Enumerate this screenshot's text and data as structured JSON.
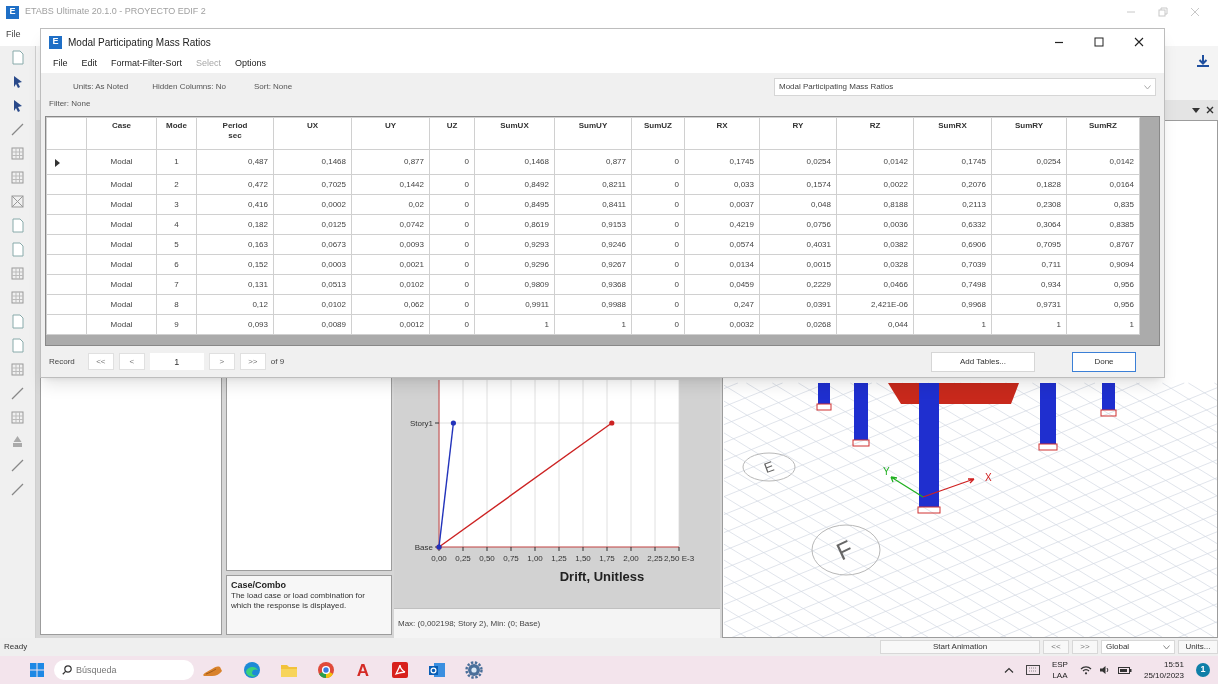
{
  "main_window": {
    "logo": "E",
    "title": "ETABS Ultimate 20.1.0 - PROYECTO EDIF 2",
    "menu": [
      "File"
    ]
  },
  "dialog": {
    "logo": "E",
    "title": "Modal Participating Mass Ratios",
    "menu": [
      {
        "label": "File",
        "disabled": false
      },
      {
        "label": "Edit",
        "disabled": false
      },
      {
        "label": "Format-Filter-Sort",
        "disabled": false
      },
      {
        "label": "Select",
        "disabled": true
      },
      {
        "label": "Options",
        "disabled": false
      }
    ],
    "info": [
      "Units: As Noted",
      "Hidden Columns: No",
      "Sort: None"
    ],
    "filter": "Filter: None",
    "table_select": "Modal Participating Mass Ratios",
    "table": {
      "columns": [
        {
          "label": "Case"
        },
        {
          "label": "Mode"
        },
        {
          "label": "Period",
          "unit": "sec"
        },
        {
          "label": "UX"
        },
        {
          "label": "UY"
        },
        {
          "label": "UZ"
        },
        {
          "label": "SumUX"
        },
        {
          "label": "SumUY"
        },
        {
          "label": "SumUZ"
        },
        {
          "label": "RX"
        },
        {
          "label": "RY"
        },
        {
          "label": "RZ"
        },
        {
          "label": "SumRX"
        },
        {
          "label": "SumRY"
        },
        {
          "label": "SumRZ"
        }
      ],
      "rows": [
        {
          "selected": true,
          "cells": [
            "Modal",
            "1",
            "0,487",
            "0,1468",
            "0,877",
            "0",
            "0,1468",
            "0,877",
            "0",
            "0,1745",
            "0,0254",
            "0,0142",
            "0,1745",
            "0,0254",
            "0,0142"
          ]
        },
        {
          "selected": false,
          "cells": [
            "Modal",
            "2",
            "0,472",
            "0,7025",
            "0,1442",
            "0",
            "0,8492",
            "0,8211",
            "0",
            "0,033",
            "0,1574",
            "0,0022",
            "0,2076",
            "0,1828",
            "0,0164"
          ]
        },
        {
          "selected": false,
          "cells": [
            "Modal",
            "3",
            "0,416",
            "0,0002",
            "0,02",
            "0",
            "0,8495",
            "0,8411",
            "0",
            "0,0037",
            "0,048",
            "0,8188",
            "0,2113",
            "0,2308",
            "0,835"
          ]
        },
        {
          "selected": false,
          "cells": [
            "Modal",
            "4",
            "0,182",
            "0,0125",
            "0,0742",
            "0",
            "0,8619",
            "0,9153",
            "0",
            "0,4219",
            "0,0756",
            "0,0036",
            "0,6332",
            "0,3064",
            "0,8385"
          ]
        },
        {
          "selected": false,
          "cells": [
            "Modal",
            "5",
            "0,163",
            "0,0673",
            "0,0093",
            "0",
            "0,9293",
            "0,9246",
            "0",
            "0,0574",
            "0,4031",
            "0,0382",
            "0,6906",
            "0,7095",
            "0,8767"
          ]
        },
        {
          "selected": false,
          "cells": [
            "Modal",
            "6",
            "0,152",
            "0,0003",
            "0,0021",
            "0",
            "0,9296",
            "0,9267",
            "0",
            "0,0134",
            "0,0015",
            "0,0328",
            "0,7039",
            "0,711",
            "0,9094"
          ]
        },
        {
          "selected": false,
          "cells": [
            "Modal",
            "7",
            "0,131",
            "0,0513",
            "0,0102",
            "0",
            "0,9809",
            "0,9368",
            "0",
            "0,0459",
            "0,2229",
            "0,0466",
            "0,7498",
            "0,934",
            "0,956"
          ]
        },
        {
          "selected": false,
          "cells": [
            "Modal",
            "8",
            "0,12",
            "0,0102",
            "0,062",
            "0",
            "0,9911",
            "0,9988",
            "0",
            "0,247",
            "0,0391",
            "2,421E-06",
            "0,9968",
            "0,9731",
            "0,956"
          ]
        },
        {
          "selected": false,
          "cells": [
            "Modal",
            "9",
            "0,093",
            "0,0089",
            "0,0012",
            "0",
            "1",
            "1",
            "0",
            "0,0032",
            "0,0268",
            "0,044",
            "1",
            "1",
            "1"
          ]
        }
      ]
    },
    "record_nav": {
      "label": "Record",
      "first": "<<",
      "prev": "<",
      "value": "1",
      "next": ">",
      "last": ">>",
      "count": "of 9"
    },
    "buttons": [
      {
        "label": "Add Tables...",
        "default": false
      },
      {
        "label": "Done",
        "default": true
      }
    ]
  },
  "help_box": {
    "title": "Case/Combo",
    "text": "The load case or load combination for which the response is displayed."
  },
  "drift_plot": {
    "chart_data": {
      "type": "line",
      "orientation": "horizontal",
      "grid": true,
      "xlabel": "Drift, Unitless",
      "categories": [
        "Story1",
        "Base"
      ],
      "xlim": [
        0,
        2.5
      ],
      "xticks": [
        {
          "value": 0,
          "label": "0,00"
        },
        {
          "value": 0.25,
          "label": "0,25"
        },
        {
          "value": 0.5,
          "label": "0,50"
        },
        {
          "value": 0.75,
          "label": "0,75"
        },
        {
          "value": 1,
          "label": "1,00"
        },
        {
          "value": 1.25,
          "label": "1,25"
        },
        {
          "value": 1.5,
          "label": "1,50"
        },
        {
          "value": 1.75,
          "label": "1,75"
        },
        {
          "value": 2,
          "label": "2,00"
        },
        {
          "value": 2.25,
          "label": "2,25"
        },
        {
          "value": 2.5,
          "label": "2,50 E-3"
        }
      ],
      "series": [
        {
          "color": "#cc2222",
          "values": [
            1.8,
            0
          ]
        },
        {
          "color": "#2233bb",
          "values": [
            0.15,
            0
          ]
        }
      ]
    },
    "footer": "Max: (0,002198; Story 2),  Min: (0; Base)"
  },
  "model_view": {
    "grid_labels": [
      "E",
      "F"
    ],
    "axes": [
      "X",
      "Y"
    ]
  },
  "status_bar": {
    "text": "Ready",
    "animation_button": "Start Animation",
    "prev": "<<",
    "next": ">>",
    "coord_system": "Global",
    "units_button": "Units..."
  },
  "taskbar": {
    "search_placeholder": "Búsqueda",
    "apps": [
      {
        "kind": "widget"
      },
      {
        "kind": "edge"
      },
      {
        "kind": "folder"
      },
      {
        "kind": "chrome"
      },
      {
        "kind": "letter",
        "label": "A"
      },
      {
        "kind": "pdf"
      },
      {
        "kind": "mail"
      },
      {
        "kind": "settings"
      }
    ],
    "language": "ESP",
    "layout": "LAA",
    "time": "15:51",
    "date": "25/10/2023",
    "notifications": "1"
  }
}
